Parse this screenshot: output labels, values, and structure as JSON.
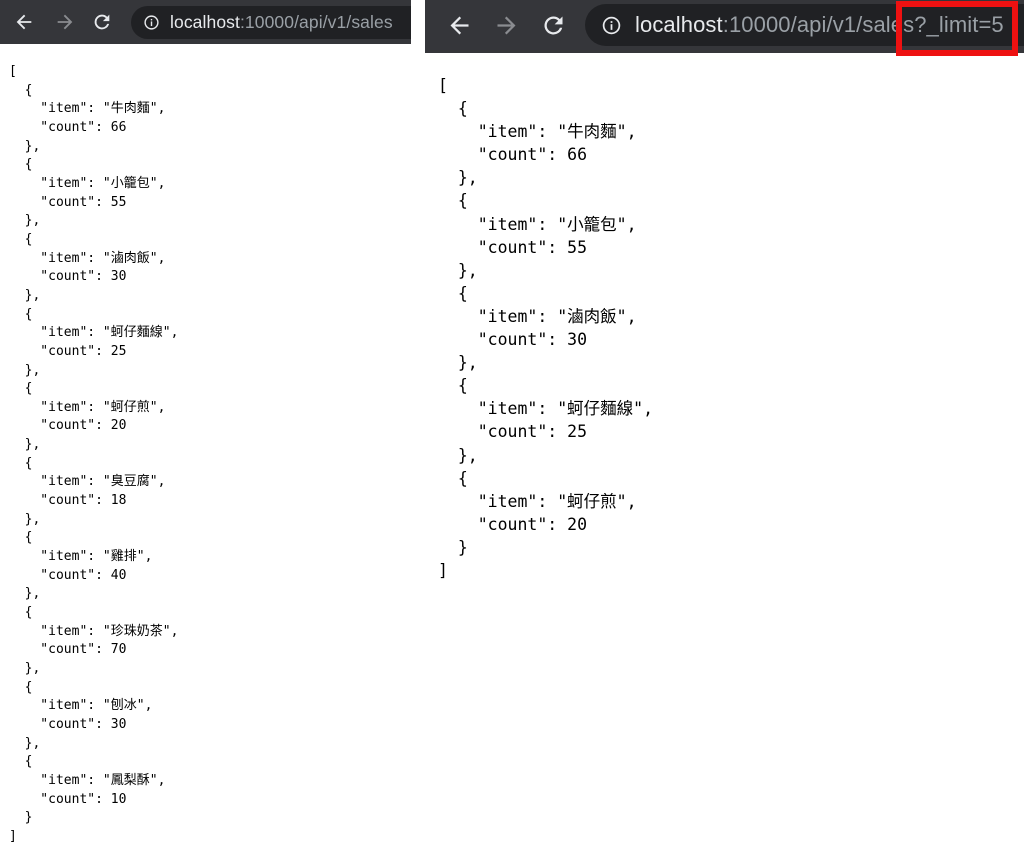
{
  "left_window": {
    "address_bar": {
      "host": "localhost",
      "rest": ":10000/api/v1/sales"
    },
    "json_text": "[\n  {\n    \"item\": \"牛肉麵\",\n    \"count\": 66\n  },\n  {\n    \"item\": \"小籠包\",\n    \"count\": 55\n  },\n  {\n    \"item\": \"滷肉飯\",\n    \"count\": 30\n  },\n  {\n    \"item\": \"蚵仔麵線\",\n    \"count\": 25\n  },\n  {\n    \"item\": \"蚵仔煎\",\n    \"count\": 20\n  },\n  {\n    \"item\": \"臭豆腐\",\n    \"count\": 18\n  },\n  {\n    \"item\": \"雞排\",\n    \"count\": 40\n  },\n  {\n    \"item\": \"珍珠奶茶\",\n    \"count\": 70\n  },\n  {\n    \"item\": \"刨冰\",\n    \"count\": 30\n  },\n  {\n    \"item\": \"鳳梨酥\",\n    \"count\": 10\n  }\n]"
  },
  "right_window": {
    "address_bar": {
      "host": "localhost",
      "rest": ":10000/api/v1/sales?_limit=5"
    },
    "json_text": "[\n  {\n    \"item\": \"牛肉麵\",\n    \"count\": 66\n  },\n  {\n    \"item\": \"小籠包\",\n    \"count\": 55\n  },\n  {\n    \"item\": \"滷肉飯\",\n    \"count\": 30\n  },\n  {\n    \"item\": \"蚵仔麵線\",\n    \"count\": 25\n  },\n  {\n    \"item\": \"蚵仔煎\",\n    \"count\": 20\n  }\n]"
  },
  "icons": {
    "back": "arrow-left-icon",
    "forward": "arrow-right-icon",
    "reload": "reload-icon",
    "site_info": "info-circle-icon"
  },
  "colors": {
    "toolbar": "#35363a",
    "omnibox": "#202124",
    "url_host": "#e8eaed",
    "url_path": "#9aa0a6",
    "annotation": "#ee1111"
  }
}
